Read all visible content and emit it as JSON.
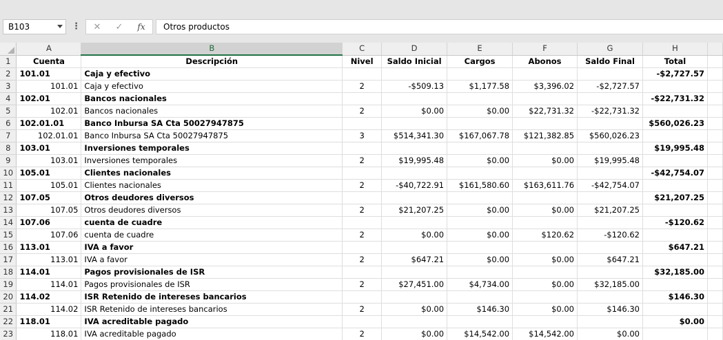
{
  "formula_bar": {
    "name_box": "B103",
    "content": "Otros productos",
    "cancel_icon": "✕",
    "enter_icon": "✓",
    "fx_label": "fx"
  },
  "columns": [
    "A",
    "B",
    "C",
    "D",
    "E",
    "F",
    "G",
    "H"
  ],
  "active_column": "B",
  "header_row": {
    "row": "1",
    "cells": [
      "Cuenta",
      "Descripción",
      "Nivel",
      "Saldo Inicial",
      "Cargos",
      "Abonos",
      "Saldo Final",
      "Total"
    ]
  },
  "rows": [
    {
      "row": "2",
      "group": true,
      "cells": [
        "101.01",
        "Caja y efectivo",
        "",
        "",
        "",
        "",
        "",
        "-$2,727.57"
      ]
    },
    {
      "row": "3",
      "group": false,
      "cells": [
        "101.01",
        "Caja y efectivo",
        "2",
        "-$509.13",
        "$1,177.58",
        "$3,396.02",
        "-$2,727.57",
        ""
      ]
    },
    {
      "row": "4",
      "group": true,
      "cells": [
        "102.01",
        "Bancos nacionales",
        "",
        "",
        "",
        "",
        "",
        "-$22,731.32"
      ]
    },
    {
      "row": "5",
      "group": false,
      "cells": [
        "102.01",
        "Bancos nacionales",
        "2",
        "$0.00",
        "$0.00",
        "$22,731.32",
        "-$22,731.32",
        ""
      ]
    },
    {
      "row": "6",
      "group": true,
      "cells": [
        "102.01.01",
        "Banco Inbursa SA Cta 50027947875",
        "",
        "",
        "",
        "",
        "",
        "$560,026.23"
      ]
    },
    {
      "row": "7",
      "group": false,
      "cells": [
        "102.01.01",
        "Banco Inbursa SA Cta 50027947875",
        "3",
        "$514,341.30",
        "$167,067.78",
        "$121,382.85",
        "$560,026.23",
        ""
      ]
    },
    {
      "row": "8",
      "group": true,
      "cells": [
        "103.01",
        "Inversiones temporales",
        "",
        "",
        "",
        "",
        "",
        "$19,995.48"
      ]
    },
    {
      "row": "9",
      "group": false,
      "cells": [
        "103.01",
        "Inversiones temporales",
        "2",
        "$19,995.48",
        "$0.00",
        "$0.00",
        "$19,995.48",
        ""
      ]
    },
    {
      "row": "10",
      "group": true,
      "cells": [
        "105.01",
        "Clientes nacionales",
        "",
        "",
        "",
        "",
        "",
        "-$42,754.07"
      ]
    },
    {
      "row": "11",
      "group": false,
      "cells": [
        "105.01",
        "Clientes nacionales",
        "2",
        "-$40,722.91",
        "$161,580.60",
        "$163,611.76",
        "-$42,754.07",
        ""
      ]
    },
    {
      "row": "12",
      "group": true,
      "cells": [
        "107.05",
        "Otros deudores diversos",
        "",
        "",
        "",
        "",
        "",
        "$21,207.25"
      ]
    },
    {
      "row": "13",
      "group": false,
      "cells": [
        "107.05",
        "Otros deudores diversos",
        "2",
        "$21,207.25",
        "$0.00",
        "$0.00",
        "$21,207.25",
        ""
      ]
    },
    {
      "row": "14",
      "group": true,
      "cells": [
        "107.06",
        "cuenta de cuadre",
        "",
        "",
        "",
        "",
        "",
        "-$120.62"
      ]
    },
    {
      "row": "15",
      "group": false,
      "cells": [
        "107.06",
        "cuenta de cuadre",
        "2",
        "$0.00",
        "$0.00",
        "$120.62",
        "-$120.62",
        ""
      ]
    },
    {
      "row": "16",
      "group": true,
      "cells": [
        "113.01",
        "IVA a favor",
        "",
        "",
        "",
        "",
        "",
        "$647.21"
      ]
    },
    {
      "row": "17",
      "group": false,
      "cells": [
        "113.01",
        "IVA a favor",
        "2",
        "$647.21",
        "$0.00",
        "$0.00",
        "$647.21",
        ""
      ]
    },
    {
      "row": "18",
      "group": true,
      "cells": [
        "114.01",
        "Pagos provisionales de ISR",
        "",
        "",
        "",
        "",
        "",
        "$32,185.00"
      ]
    },
    {
      "row": "19",
      "group": false,
      "cells": [
        "114.01",
        "Pagos provisionales de ISR",
        "2",
        "$27,451.00",
        "$4,734.00",
        "$0.00",
        "$32,185.00",
        ""
      ]
    },
    {
      "row": "20",
      "group": true,
      "cells": [
        "114.02",
        "ISR Retenido de intereses bancarios",
        "",
        "",
        "",
        "",
        "",
        "$146.30"
      ]
    },
    {
      "row": "21",
      "group": false,
      "cells": [
        "114.02",
        "ISR Retenido de intereses bancarios",
        "2",
        "$0.00",
        "$146.30",
        "$0.00",
        "$146.30",
        ""
      ]
    },
    {
      "row": "22",
      "group": true,
      "cells": [
        "118.01",
        "IVA acreditable pagado",
        "",
        "",
        "",
        "",
        "",
        "$0.00"
      ]
    },
    {
      "row": "23",
      "group": false,
      "cells": [
        "118.01",
        "IVA acreditable pagado",
        "2",
        "$0.00",
        "$14,542.00",
        "$14,542.00",
        "$0.00",
        ""
      ]
    }
  ]
}
